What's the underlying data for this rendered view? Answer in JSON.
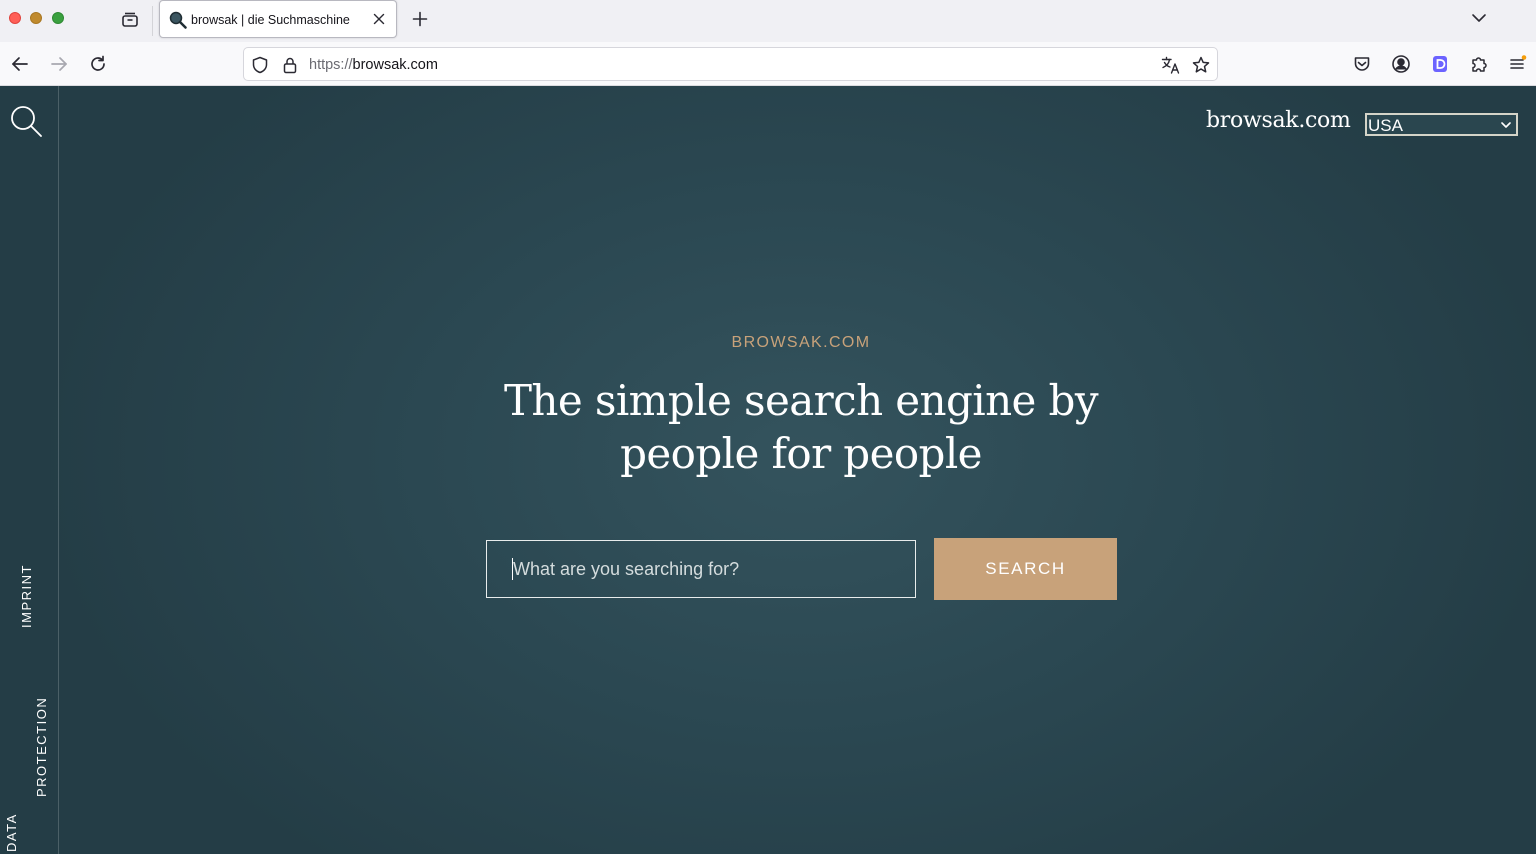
{
  "browser": {
    "tab": {
      "title": "browsak | die Suchmaschine"
    },
    "url": {
      "scheme": "https://",
      "host": "browsak.com"
    },
    "icons": {
      "tab_overview": "tab-overview-icon",
      "favicon": "magnifier-favicon-icon",
      "close": "close-icon",
      "new_tab": "plus-icon",
      "tab_list": "chevron-down-icon",
      "back": "arrow-left-icon",
      "forward": "arrow-right-icon",
      "reload": "reload-icon",
      "tracking": "shield-icon",
      "lock": "lock-icon",
      "translate": "translate-icon",
      "bookmark": "star-icon",
      "pocket": "pocket-icon",
      "account": "account-icon",
      "extension_d": "d-extension-icon",
      "extensions": "puzzle-icon",
      "menu": "hamburger-menu-icon"
    }
  },
  "page": {
    "sidebar": {
      "imprint": "IMPRINT",
      "data_protection_line1": "DATA",
      "data_protection_line2": "PROTECTION"
    },
    "header": {
      "site_name": "browsak.com",
      "country": "USA"
    },
    "hero": {
      "kicker": "BROWSAK.COM",
      "headline_line1": "The simple search engine by",
      "headline_line2": "people for people"
    },
    "search": {
      "placeholder": "What are you searching for?",
      "button_label": "SEARCH"
    },
    "colors": {
      "background": "#2b4852",
      "accent": "#c8a27a",
      "text": "#ffffff"
    }
  }
}
